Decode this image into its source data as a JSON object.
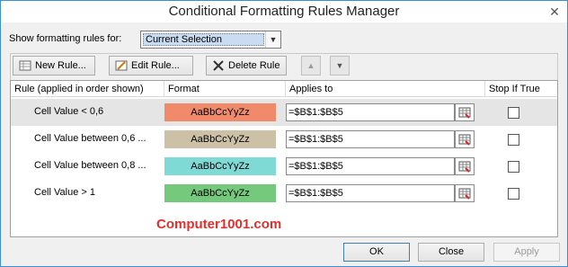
{
  "window": {
    "title": "Conditional Formatting Rules Manager"
  },
  "show_rules": {
    "label": "Show formatting rules for:",
    "selected": "Current Selection"
  },
  "toolbar": {
    "new_rule": "New Rule...",
    "edit_rule": "Edit Rule...",
    "delete_rule": "Delete Rule"
  },
  "columns": {
    "rule": "Rule (applied in order shown)",
    "format": "Format",
    "applies_to": "Applies to",
    "stop_if_true": "Stop If True"
  },
  "rules": [
    {
      "rule": "Cell Value < 0,6",
      "preview": "AaBbCcYyZz",
      "applies_to": "=$B$1:$B$5",
      "color": "#f08a6a",
      "stop": false
    },
    {
      "rule": "Cell Value between 0,6 ...",
      "preview": "AaBbCcYyZz",
      "applies_to": "=$B$1:$B$5",
      "color": "#ccc1a6",
      "stop": false
    },
    {
      "rule": "Cell Value between 0,8 ...",
      "preview": "AaBbCcYyZz",
      "applies_to": "=$B$1:$B$5",
      "color": "#7fdad5",
      "stop": false
    },
    {
      "rule": "Cell Value > 1",
      "preview": "AaBbCcYyZz",
      "applies_to": "=$B$1:$B$5",
      "color": "#74c97d",
      "stop": false
    }
  ],
  "watermark": "Computer1001.com",
  "buttons": {
    "ok": "OK",
    "close": "Close",
    "apply": "Apply"
  }
}
